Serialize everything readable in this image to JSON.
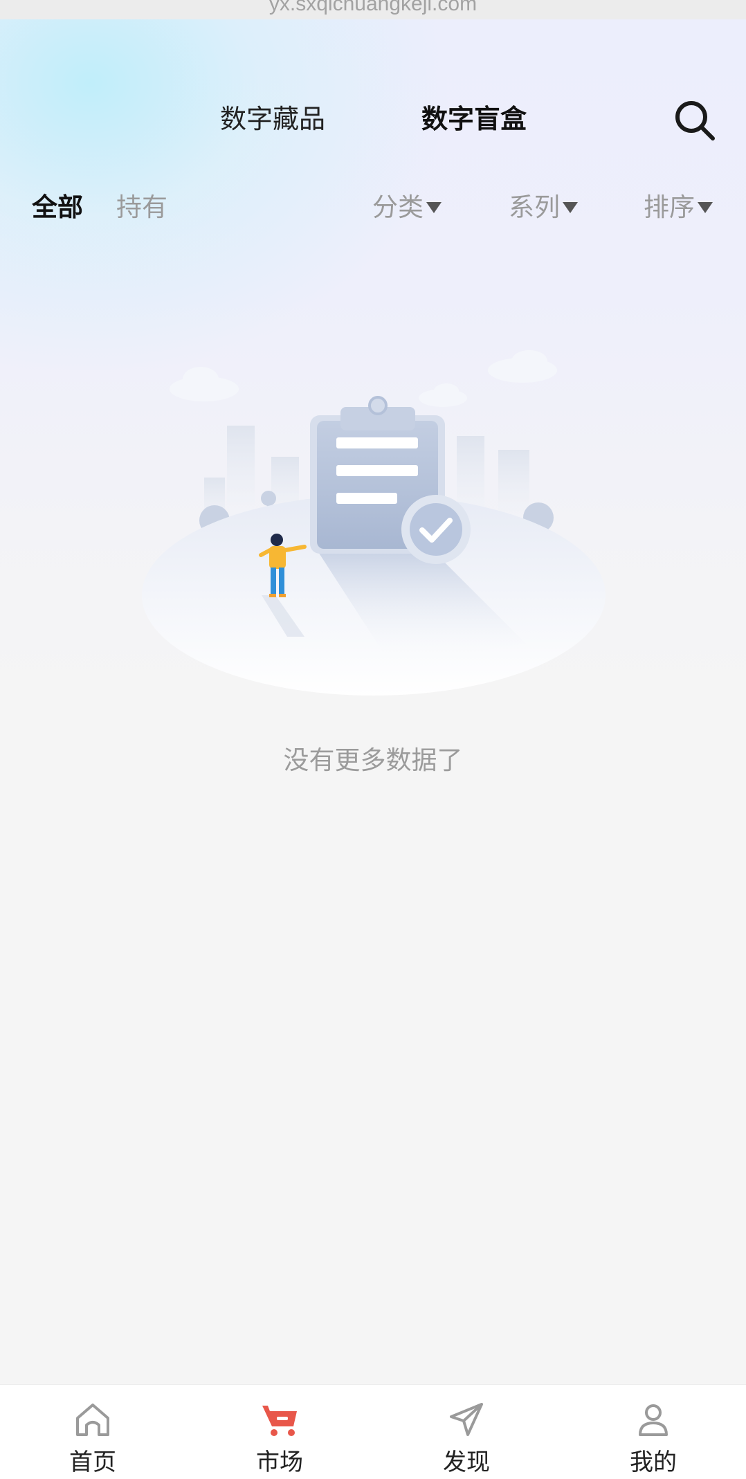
{
  "browser": {
    "url": "yx.sxqichuangkeji.com"
  },
  "header": {
    "tabs": [
      {
        "label": "数字藏品",
        "active": false
      },
      {
        "label": "数字盲盒",
        "active": true
      }
    ],
    "search_icon": "search-icon"
  },
  "filters": {
    "all_label": "全部",
    "owned_label": "持有",
    "category_label": "分类",
    "series_label": "系列",
    "sort_label": "排序",
    "dropdown_icon": "triangle-down-icon"
  },
  "empty_state": {
    "illustration": "empty-clipboard-illustration",
    "message": "没有更多数据了"
  },
  "bottom_nav": {
    "items": [
      {
        "label": "首页",
        "icon": "home-icon",
        "active": false
      },
      {
        "label": "市场",
        "icon": "cart-icon",
        "active": true
      },
      {
        "label": "发现",
        "icon": "send-icon",
        "active": false
      },
      {
        "label": "我的",
        "icon": "user-icon",
        "active": false
      }
    ]
  },
  "colors": {
    "accent": "#e8574a",
    "text_primary": "#111111",
    "text_muted": "#9a9a9a",
    "background": "#f5f5f5"
  }
}
